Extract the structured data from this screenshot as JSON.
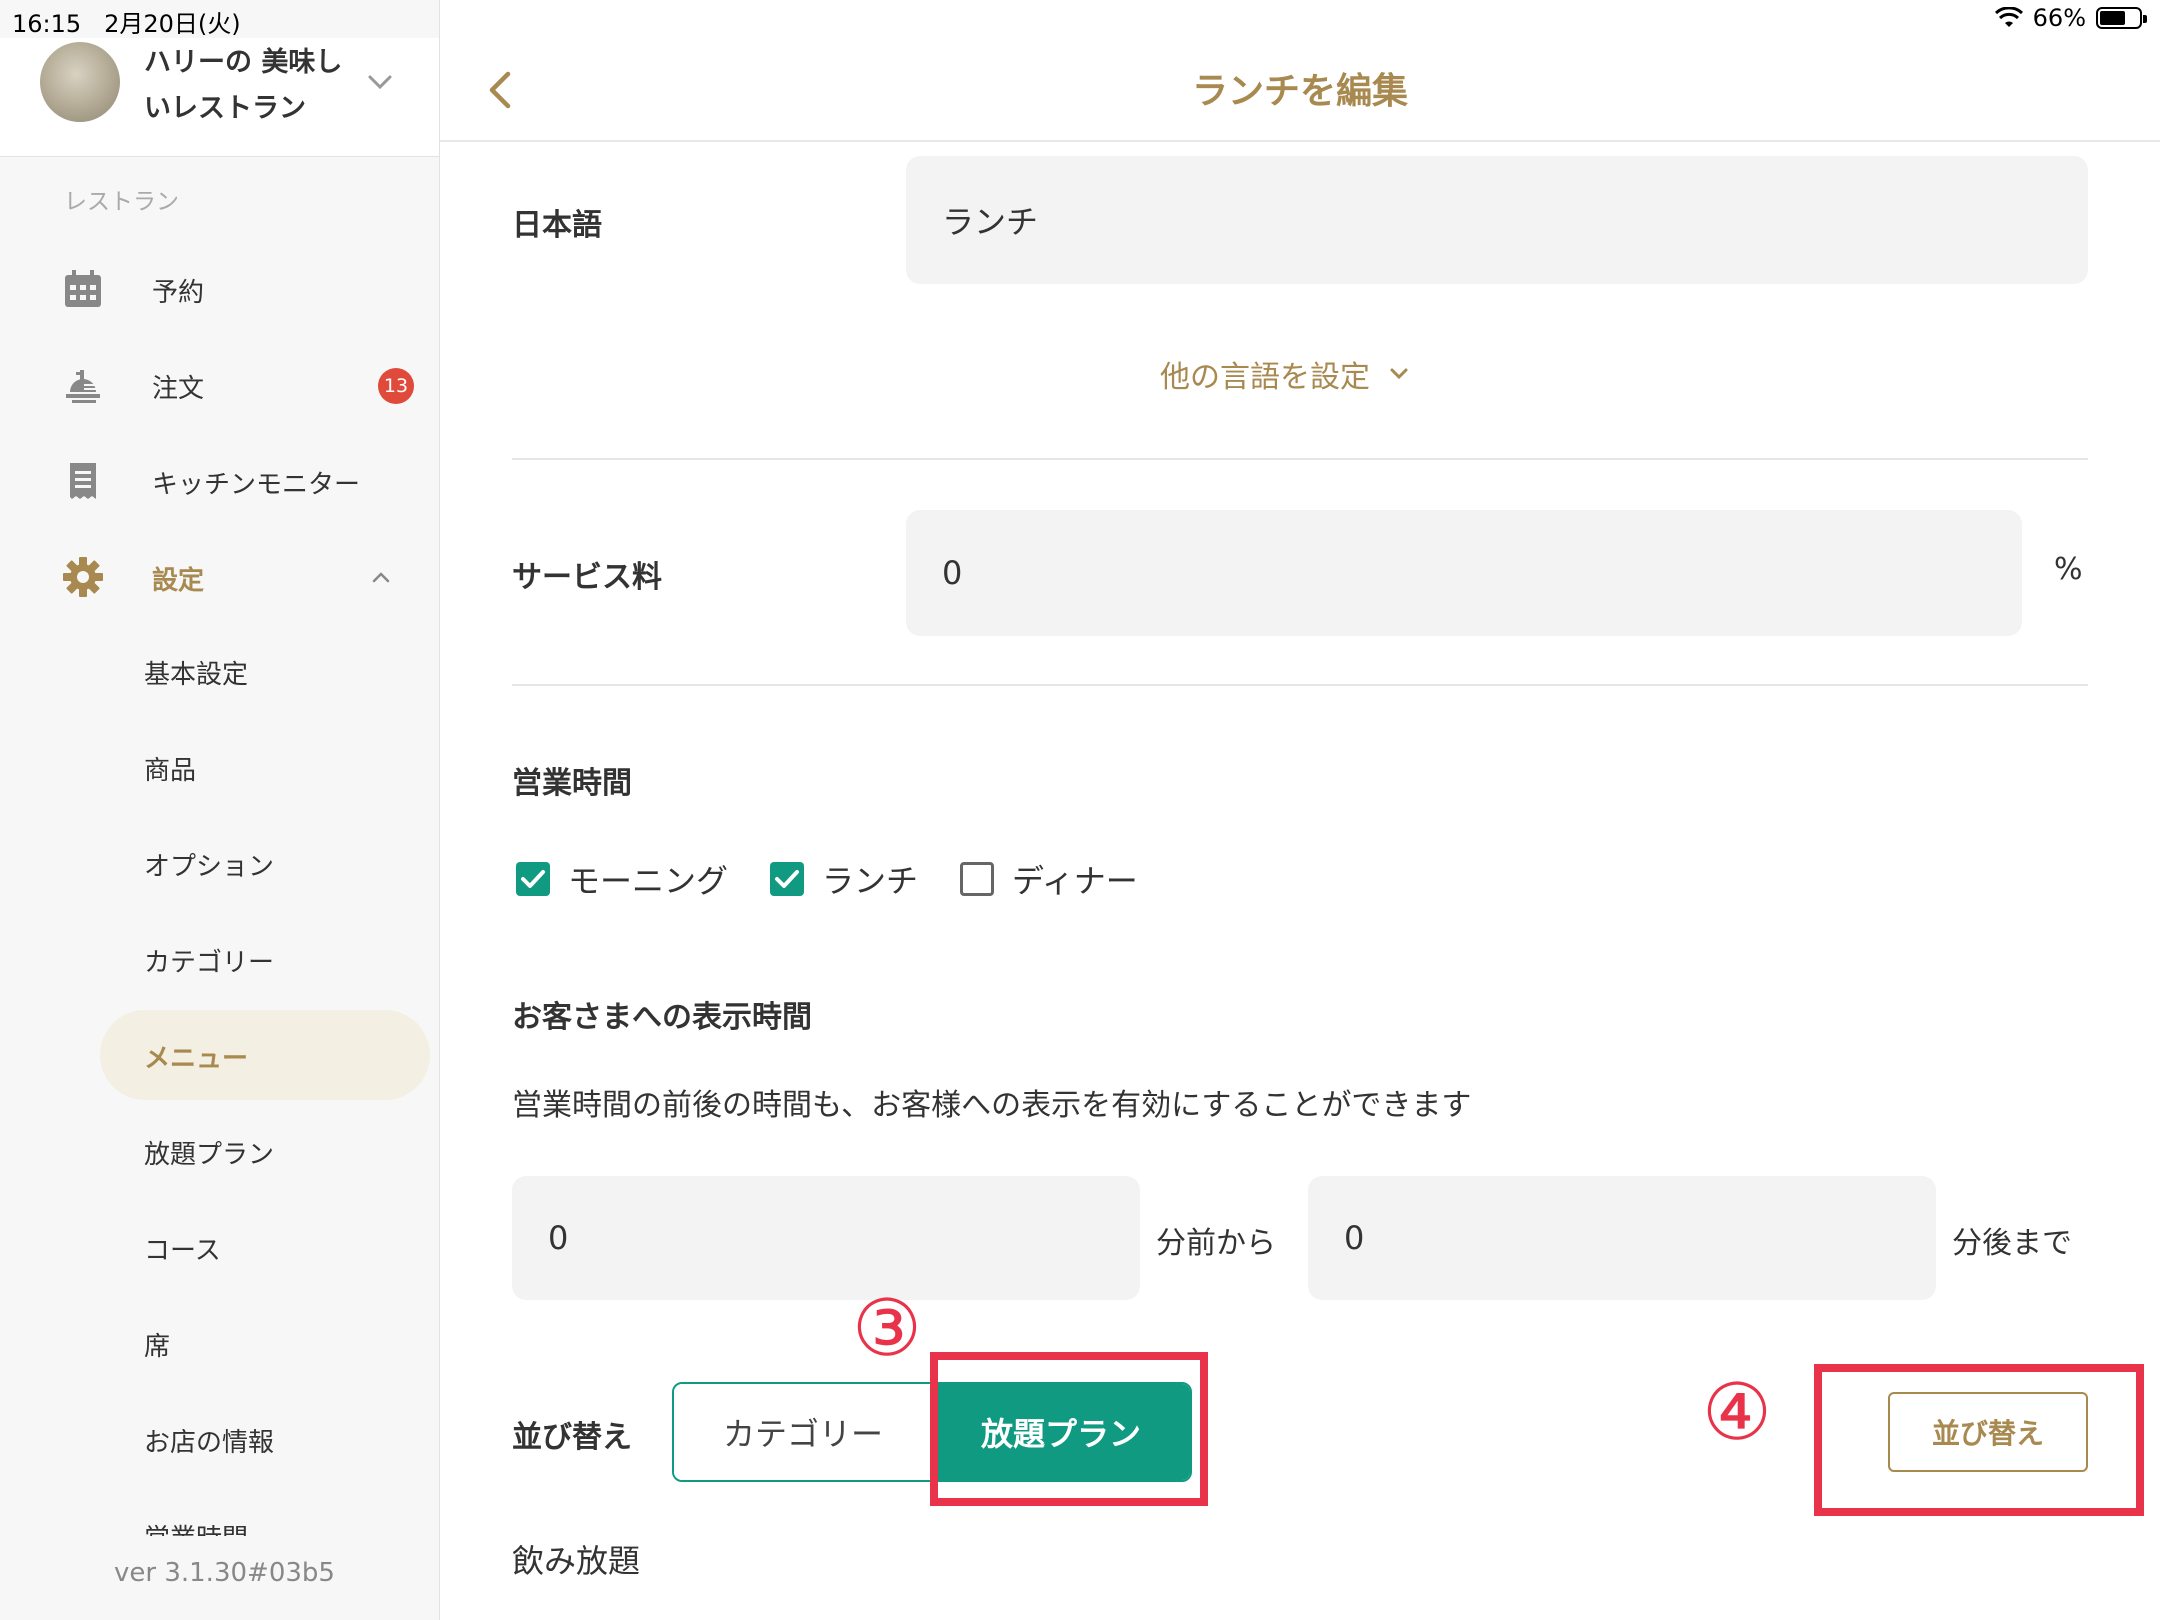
{
  "status_bar": {
    "time": "16:15",
    "date": "2月20日(火)",
    "battery_percent": "66%",
    "battery_level": 0.66
  },
  "sidebar": {
    "restaurant_name": "ハリーの 美味しいレストラン",
    "section_label": "レストラン",
    "nav": [
      {
        "label": "予約",
        "icon": "calendar-icon"
      },
      {
        "label": "注文",
        "icon": "order-tray-icon",
        "badge": "13"
      },
      {
        "label": "キッチンモニター",
        "icon": "receipt-icon"
      },
      {
        "label": "設定",
        "icon": "gear-icon"
      }
    ],
    "settings_sub": [
      "基本設定",
      "商品",
      "オプション",
      "カテゴリー",
      "メニュー",
      "放題プラン",
      "コース",
      "席",
      "お店の情報",
      "営業時間"
    ],
    "version": "ver 3.1.30#03b5"
  },
  "main": {
    "title": "ランチを編集",
    "japanese_label": "日本語",
    "japanese_value": "ランチ",
    "other_languages": "他の言語を設定",
    "service_fee_label": "サービス料",
    "service_fee_value": "0",
    "service_fee_unit": "%",
    "business_hours_label": "営業時間",
    "checkboxes": [
      {
        "label": "モーニング",
        "checked": true
      },
      {
        "label": "ランチ",
        "checked": true
      },
      {
        "label": "ディナー",
        "checked": false
      }
    ],
    "display_time_label": "お客さまへの表示時間",
    "display_time_desc": "営業時間の前後の時間も、お客様への表示を有効にすることができます",
    "before_value": "0",
    "before_unit": "分前から",
    "after_value": "0",
    "after_unit": "分後まで",
    "sort_label": "並び替え",
    "segments": [
      "カテゴリー",
      "放題プラン"
    ],
    "sort_button": "並び替え",
    "list_first_item": "飲み放題"
  },
  "annotations": {
    "step3": "③",
    "step4": "④"
  },
  "colors": {
    "accent_gold": "#a8894f",
    "teal": "#109a82",
    "badge_red": "#e04a3a",
    "annotation_red": "#e8334a"
  }
}
